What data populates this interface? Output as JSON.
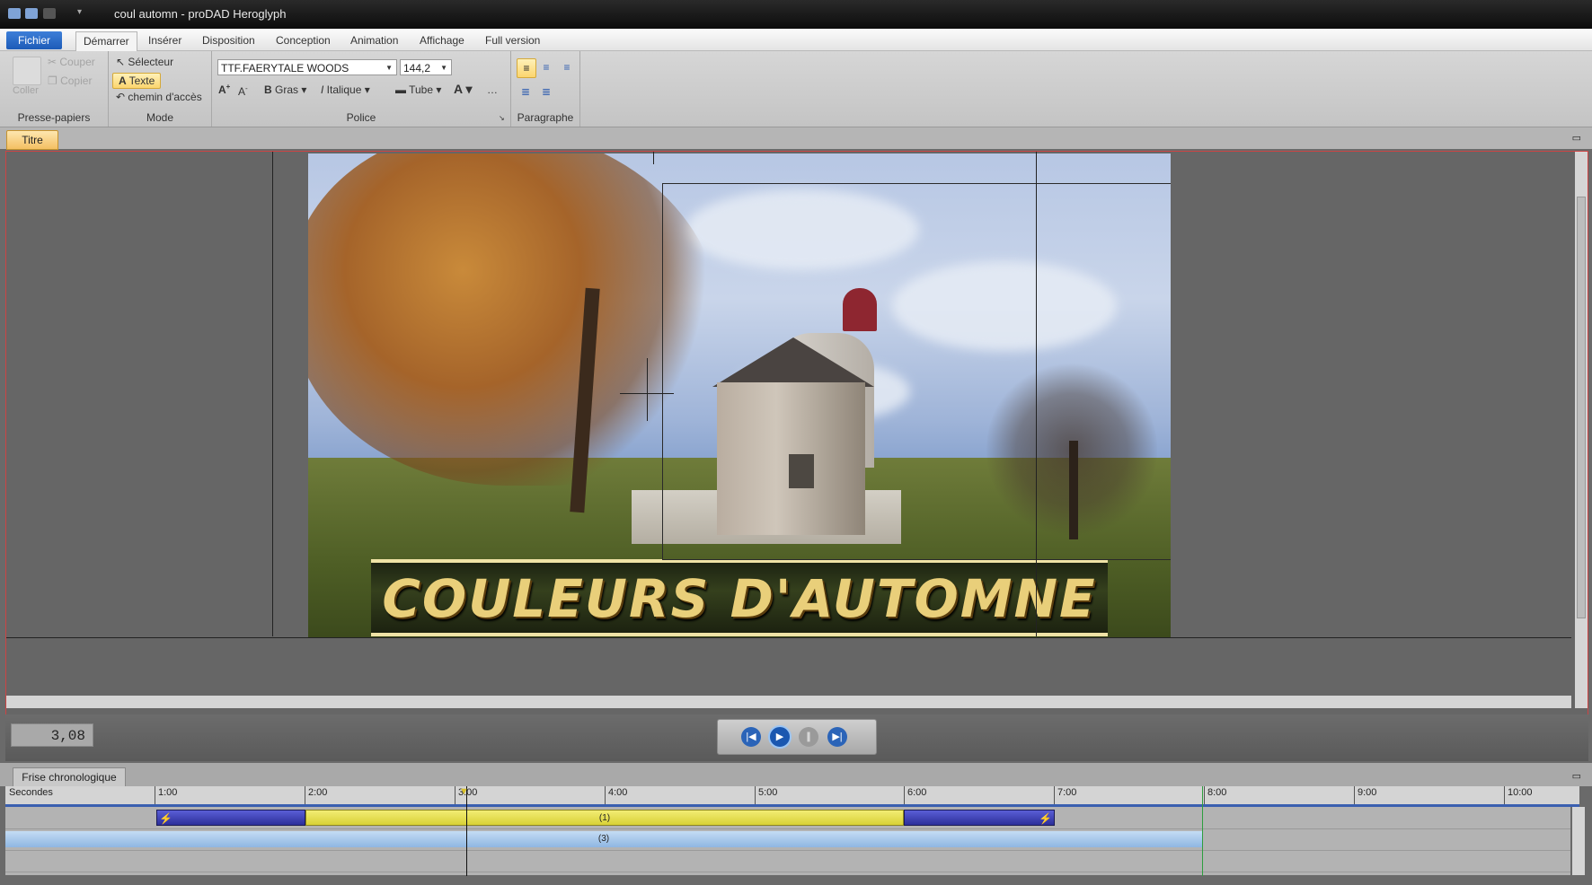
{
  "window": {
    "title": "coul automn - proDAD Heroglyph"
  },
  "ribbon_tabs": [
    "Fichier",
    "Démarrer",
    "Insérer",
    "Disposition",
    "Conception",
    "Animation",
    "Affichage",
    "Full version"
  ],
  "clipboard": {
    "paste_label": "Coller",
    "cut_label": "Couper",
    "copy_label": "Copier",
    "group_label": "Presse-papiers"
  },
  "mode": {
    "selector_label": "Sélecteur",
    "text_label": "Texte",
    "path_label": "chemin d'accès",
    "group_label": "Mode"
  },
  "font": {
    "family_value": "TTF.FAERYTALE WOODS",
    "size_value": "144,2",
    "bold_label": "Gras",
    "italic_label": "Italique",
    "outline_label": "Tube",
    "group_label": "Police"
  },
  "paragraph": {
    "group_label": "Paragraphe"
  },
  "editor": {
    "tab_label": "Titre",
    "title_text": "COULEURS D'AUTOMNE",
    "timecode": "3,08"
  },
  "timeline": {
    "tab_label": "Frise chronologique",
    "unit_label": "Secondes",
    "ticks": [
      "1:00",
      "2:00",
      "3:00",
      "4:00",
      "5:00",
      "6:00",
      "7:00",
      "8:00",
      "9:00",
      "10:00"
    ],
    "clip1_label": "(1)",
    "clip3_label": "(3)"
  },
  "colors": {
    "accent_tab": "#f4c062",
    "clip_blue": "#3c3fb0",
    "clip_yellow": "#e9e24a",
    "track_lightblue": "#a9c9ec"
  }
}
